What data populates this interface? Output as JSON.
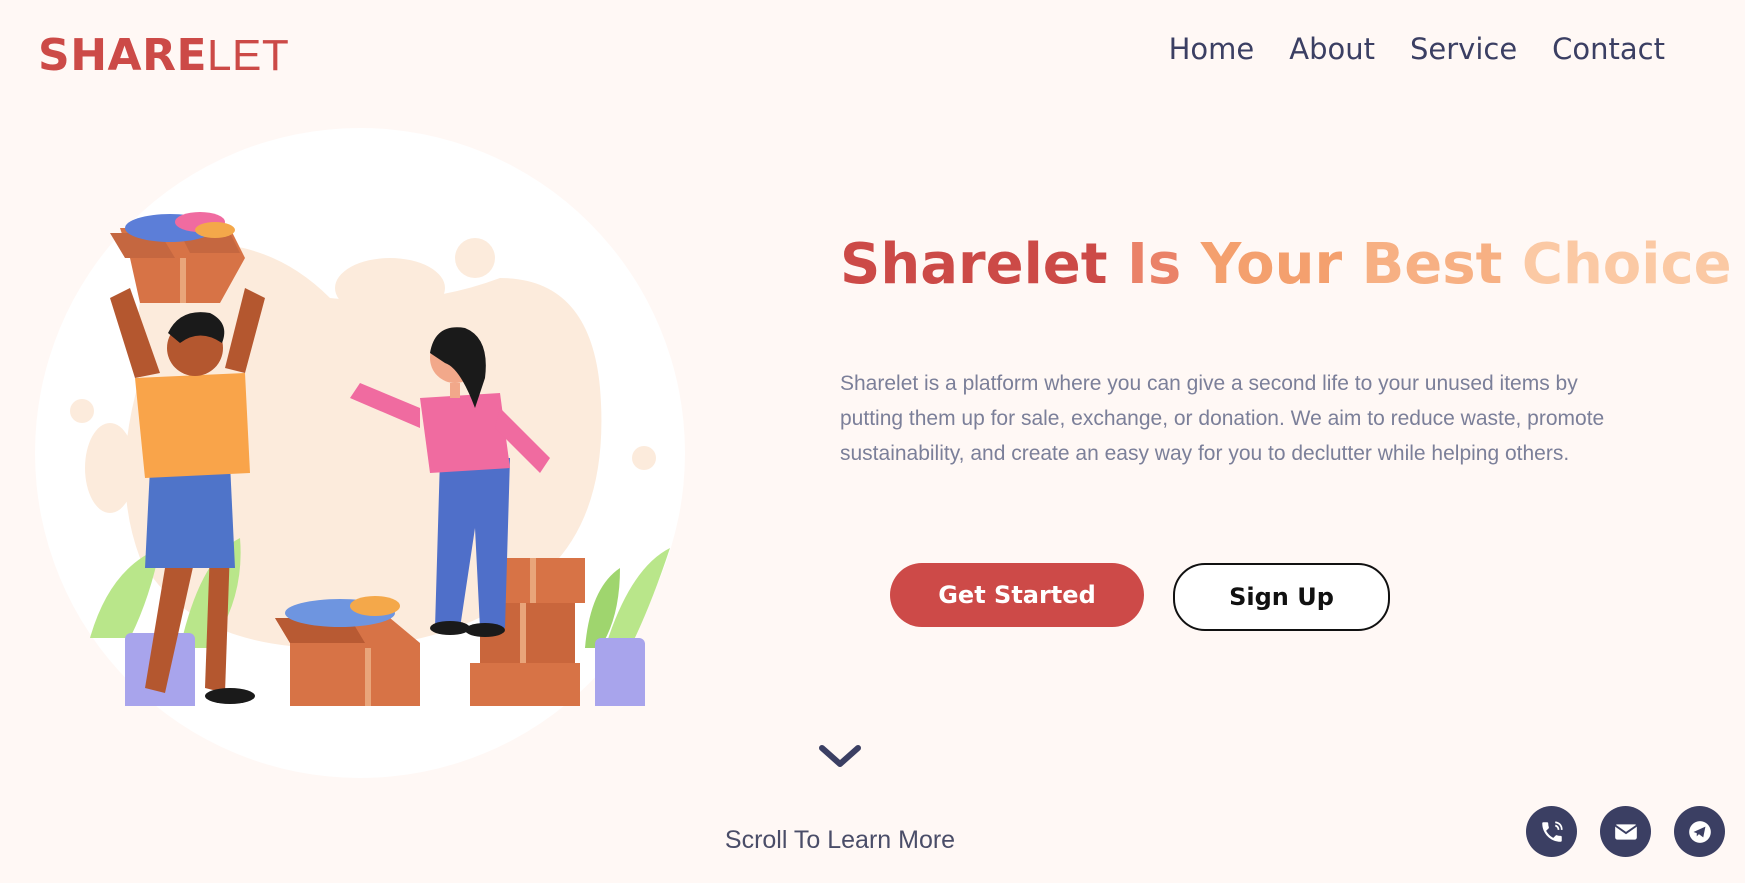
{
  "brand": {
    "logo_strong": "SHARE",
    "logo_light": "LET"
  },
  "nav": {
    "items": [
      {
        "label": "Home"
      },
      {
        "label": "About"
      },
      {
        "label": "Service"
      },
      {
        "label": "Contact"
      }
    ]
  },
  "hero": {
    "title_words": [
      "Sharelet",
      "Is",
      "Your",
      "Best",
      "Choice"
    ],
    "description": "Sharelet is a platform where you can give a second life to your unused items by putting them up for sale, exchange, or donation. We aim to reduce waste, promote sustainability, and create an easy way for you to declutter while helping others.",
    "primary_button": "Get Started",
    "secondary_button": "Sign Up"
  },
  "scroll": {
    "label": "Scroll To Learn More",
    "icon": "chevron-down-icon"
  },
  "social": {
    "icons": [
      "phone-icon",
      "mail-icon",
      "telegram-icon"
    ]
  },
  "colors": {
    "brand": "#cc4a47",
    "nav_text": "#3b3f63",
    "page_bg": "#fff8f5",
    "gradient": [
      "#cc4a47",
      "#ea8268",
      "#f4a06e",
      "#f7b083",
      "#fbc9a4"
    ]
  }
}
